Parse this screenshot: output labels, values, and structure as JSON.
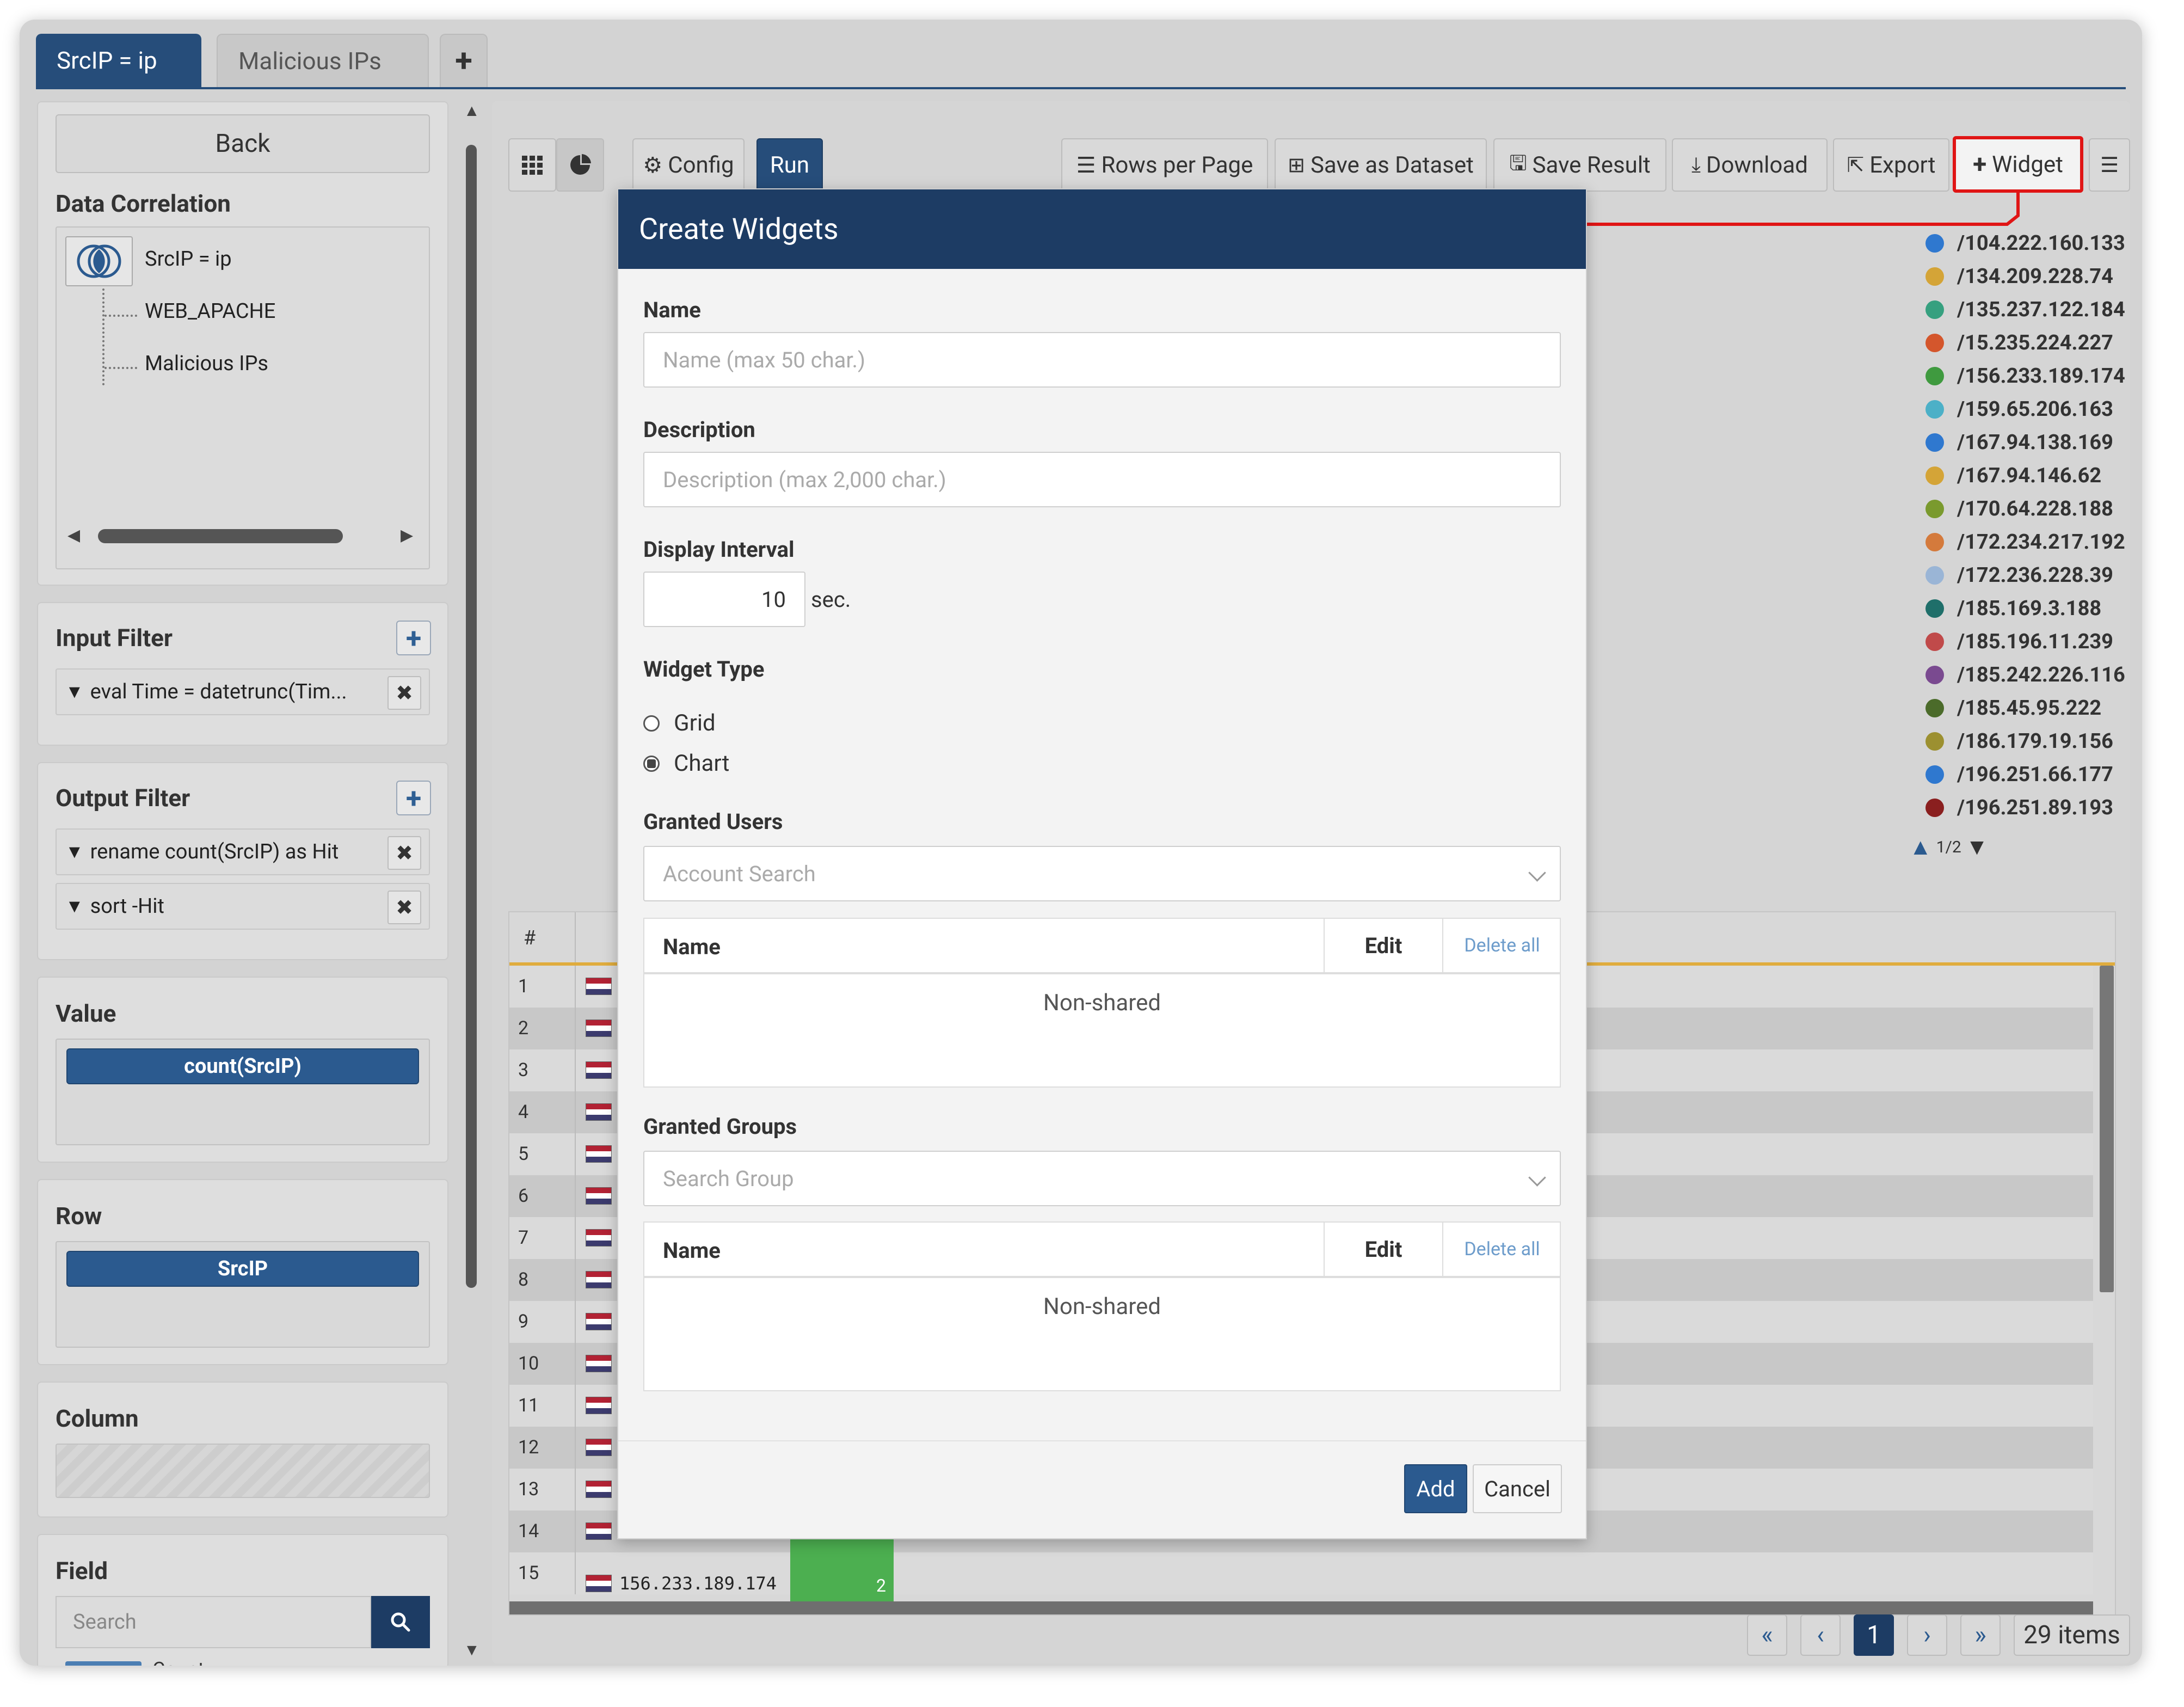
{
  "tabs": [
    {
      "label": "SrcIP = ip"
    },
    {
      "label": "Malicious IPs"
    }
  ],
  "tab_add_label": "+",
  "left_panel": {
    "back_label": "Back",
    "data_correlation": {
      "title": "Data Correlation",
      "root": "SrcIP = ip",
      "children": [
        "WEB_APACHE",
        "Malicious IPs"
      ]
    },
    "input_filter": {
      "title": "Input Filter",
      "items": [
        "eval Time = datetrunc(Tim..."
      ]
    },
    "output_filter": {
      "title": "Output Filter",
      "items": [
        "rename count(SrcIP) as Hit",
        "sort -Hit"
      ]
    },
    "value": {
      "title": "Value",
      "pill": "count(SrcIP)"
    },
    "row": {
      "title": "Row",
      "pill": "SrcIP"
    },
    "column": {
      "title": "Column"
    },
    "field": {
      "title": "Field",
      "search_placeholder": "Search",
      "partial_item": "Count"
    }
  },
  "toolbar": {
    "config_label": "Config",
    "run_label": "Run",
    "rows_per_page_label": "Rows per Page",
    "save_dataset_label": "Save as Dataset",
    "save_result_label": "Save Result",
    "download_label": "Download",
    "export_label": "Export",
    "widget_label": "Widget"
  },
  "legend": {
    "items": [
      {
        "label": "/104.222.160.133",
        "color": "#2f78cf"
      },
      {
        "label": "/134.209.228.74",
        "color": "#d4a437"
      },
      {
        "label": "/135.237.122.184",
        "color": "#36a07f"
      },
      {
        "label": "/15.235.224.227",
        "color": "#d4562c"
      },
      {
        "label": "/156.233.189.174",
        "color": "#3f9a3f"
      },
      {
        "label": "/159.65.206.163",
        "color": "#4cb0c7"
      },
      {
        "label": "/167.94.138.169",
        "color": "#2f78cf"
      },
      {
        "label": "/167.94.146.62",
        "color": "#d4a437"
      },
      {
        "label": "/170.64.228.188",
        "color": "#7a9a2e"
      },
      {
        "label": "/172.234.217.192",
        "color": "#d47a3c"
      },
      {
        "label": "/172.236.228.39",
        "color": "#9ab5d6"
      },
      {
        "label": "/185.169.3.188",
        "color": "#1f6f6a"
      },
      {
        "label": "/185.196.11.239",
        "color": "#c04a4a"
      },
      {
        "label": "/185.242.226.116",
        "color": "#7a4a90"
      },
      {
        "label": "/185.45.95.222",
        "color": "#4b6b2a"
      },
      {
        "label": "/186.179.19.156",
        "color": "#9c9030"
      },
      {
        "label": "/196.251.66.177",
        "color": "#2f78cf"
      },
      {
        "label": "/196.251.89.193",
        "color": "#8a1f1f"
      }
    ],
    "page": "1/2"
  },
  "grid": {
    "header_num": "#",
    "row_numbers": [
      "1",
      "2",
      "3",
      "4",
      "5",
      "6",
      "7",
      "8",
      "9",
      "10",
      "11",
      "12",
      "13",
      "14",
      "15"
    ],
    "last_row": {
      "ip": "156.233.189.174",
      "hit": "2"
    }
  },
  "pagination": {
    "first": "«",
    "prev": "‹",
    "current": "1",
    "next": "›",
    "last": "»",
    "total": "29 items"
  },
  "modal": {
    "title": "Create Widgets",
    "name_label": "Name",
    "name_placeholder": "Name (max 50 char.)",
    "description_label": "Description",
    "description_placeholder": "Description (max 2,000 char.)",
    "interval_label": "Display Interval",
    "interval_value": "10",
    "interval_unit": "sec.",
    "widget_type_label": "Widget Type",
    "widget_type_options": [
      "Grid",
      "Chart"
    ],
    "widget_type_selected": "Chart",
    "granted_users_label": "Granted Users",
    "users_placeholder": "Account Search",
    "granted_groups_label": "Granted Groups",
    "groups_placeholder": "Search Group",
    "table_name_header": "Name",
    "table_edit_header": "Edit",
    "table_delete_all": "Delete all",
    "table_empty": "Non-shared",
    "add_label": "Add",
    "cancel_label": "Cancel"
  },
  "colors": {
    "primary": "#264d7a",
    "modal_header": "#1d3c64",
    "highlight_border": "#e01515",
    "grid_accent": "#e0ac3d",
    "hit_bar": "#4caf50"
  }
}
